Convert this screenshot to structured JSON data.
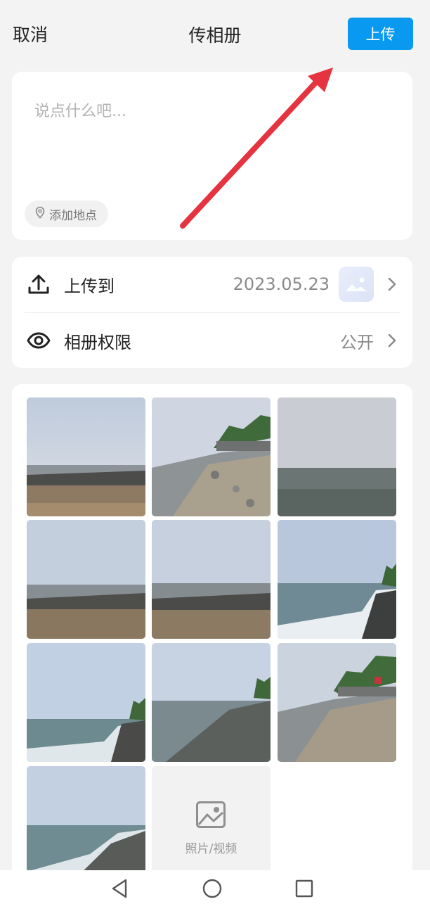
{
  "header": {
    "cancel_label": "取消",
    "title": "传相册",
    "upload_label": "上传"
  },
  "compose": {
    "placeholder": "说点什么吧...",
    "location_label": "添加地点"
  },
  "settings": {
    "upload_to": {
      "icon": "upload-icon",
      "label": "上传到",
      "value": "2023.05.23"
    },
    "privacy": {
      "icon": "eye-icon",
      "label": "相册权限",
      "value": "公开"
    }
  },
  "gallery": {
    "photo_count": 10,
    "add_tile_label": "照片/视频",
    "add_tile_icon": "image-icon"
  },
  "navbar": {
    "icons": [
      "back-triangle-icon",
      "home-circle-icon",
      "recents-square-icon"
    ]
  },
  "colors": {
    "accent": "#0a99f0",
    "annotation_arrow": "#e53340"
  }
}
